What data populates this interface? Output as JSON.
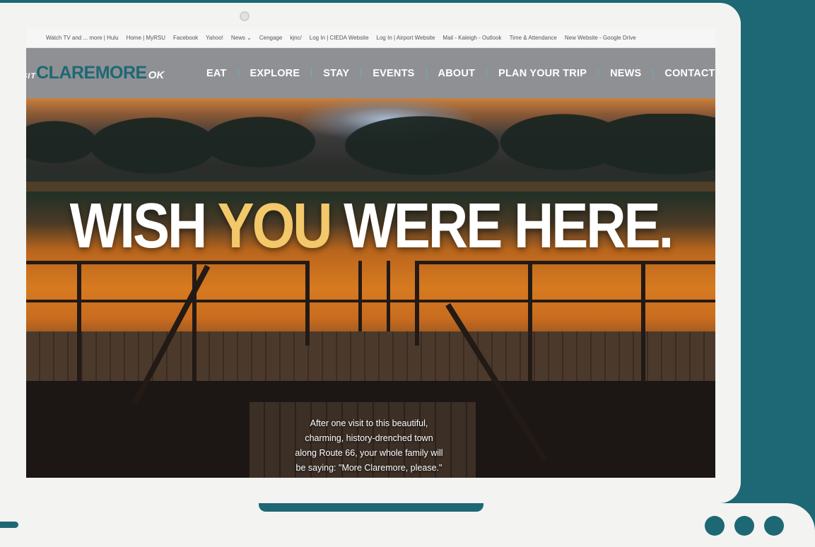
{
  "bookmarks": [
    "Watch TV and ... more | Hulu",
    "Home | MyRSU",
    "Facebook",
    "Yahoo!",
    "News",
    "Cengage",
    "kjnc/",
    "Log In | CIEDA Website",
    "Log In | Airport Website",
    "Mail - Kaleigh - Outlook",
    "Time & Attendance",
    "New Website - Google Drive"
  ],
  "logo": {
    "prefix": "SIT",
    "main": "CLAREMORE",
    "suffix": "OK"
  },
  "nav": [
    {
      "label": "EAT"
    },
    {
      "label": "EXPLORE"
    },
    {
      "label": "STAY"
    },
    {
      "label": "EVENTS"
    },
    {
      "label": "ABOUT"
    },
    {
      "label": "PLAN YOUR TRIP"
    },
    {
      "label": "NEWS"
    },
    {
      "label": "CONTACT US"
    }
  ],
  "hero": {
    "headline_start": "WISH ",
    "headline_accent": "YOU",
    "headline_end": " WERE HERE.",
    "tagline_lines": [
      "After one visit to this beautiful,",
      "charming, history-drenched town",
      "along Route 66, your whole family will",
      "be saying: \"More Claremore, please.\""
    ]
  },
  "colors": {
    "brand_teal": "#1d6874",
    "accent_gold": "#f2c86a",
    "nav_gray": "#8f9094"
  }
}
